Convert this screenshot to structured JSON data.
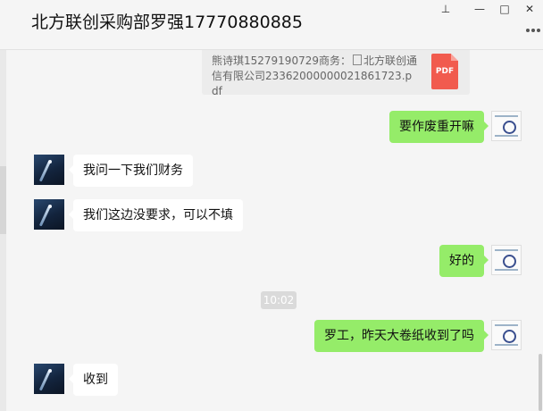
{
  "window": {
    "title": "北方联创采购部罗强17770880885",
    "pin_glyph": "⊥",
    "minimize_glyph": "—",
    "maximize_glyph": "□",
    "close_glyph": "✕"
  },
  "file_message": {
    "line1": "熊诗琪15279190729商务：",
    "filename_prefix": "北方联创通",
    "line2": "信有限公司23362000000021861723.pdf",
    "icon_label": "PDF"
  },
  "messages": [
    {
      "side": "out",
      "text": "要作废重开嘛"
    },
    {
      "side": "in",
      "text": "我问一下我们财务"
    },
    {
      "side": "in",
      "text": "我们这边没要求，可以不填"
    },
    {
      "side": "out",
      "text": "好的"
    },
    {
      "side": "out",
      "text": "罗工，昨天大卷纸收到了吗"
    },
    {
      "side": "in",
      "text": "收到"
    }
  ],
  "timestamp": "10:02",
  "colors": {
    "outgoing_bubble": "#95ec69",
    "incoming_bubble": "#ffffff",
    "background": "#f5f5f5",
    "pdf_icon": "#f15b4e"
  }
}
